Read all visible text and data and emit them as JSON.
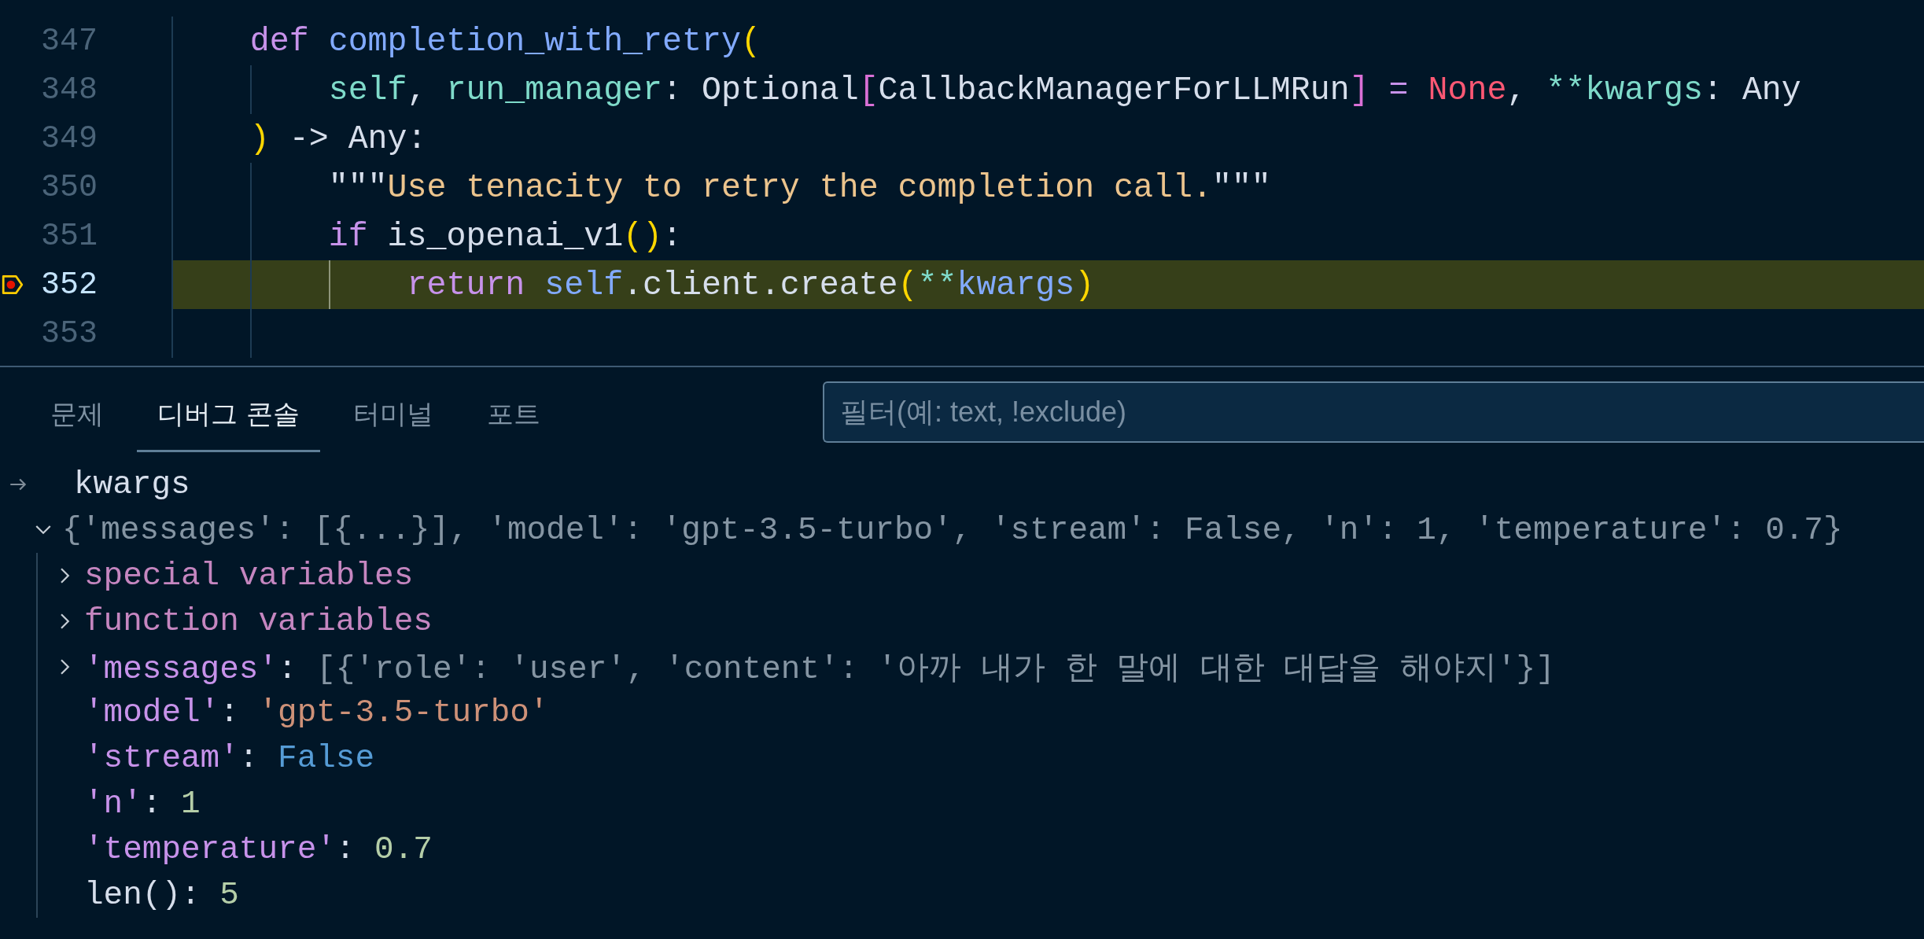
{
  "editor": {
    "lines": [
      {
        "number": "347",
        "current": false,
        "breakpoint": false,
        "tokens": [
          {
            "kind": "keyword",
            "text": "    def"
          },
          {
            "kind": "function",
            "text": " completion_with_retry"
          },
          {
            "kind": "bracket1",
            "text": "("
          }
        ]
      },
      {
        "number": "348",
        "current": false,
        "breakpoint": false,
        "tokens": [
          {
            "kind": "param",
            "text": "        self"
          },
          {
            "kind": "plain",
            "text": ", "
          },
          {
            "kind": "param",
            "text": "run_manager"
          },
          {
            "kind": "plain",
            "text": ": Optional"
          },
          {
            "kind": "bracket2",
            "text": "["
          },
          {
            "kind": "plain",
            "text": "CallbackManagerForLLMRun"
          },
          {
            "kind": "bracket2",
            "text": "]"
          },
          {
            "kind": "operator",
            "text": " = "
          },
          {
            "kind": "constant",
            "text": "None"
          },
          {
            "kind": "plain",
            "text": ", "
          },
          {
            "kind": "param",
            "text": "**kwargs"
          },
          {
            "kind": "plain",
            "text": ": Any"
          }
        ]
      },
      {
        "number": "349",
        "current": false,
        "breakpoint": false,
        "tokens": [
          {
            "kind": "bracket1",
            "text": "    )"
          },
          {
            "kind": "plain",
            "text": " -> Any:"
          }
        ]
      },
      {
        "number": "350",
        "current": false,
        "breakpoint": false,
        "tokens": [
          {
            "kind": "plain",
            "text": "        \"\"\""
          },
          {
            "kind": "string",
            "text": "Use tenacity to retry the completion call."
          },
          {
            "kind": "plain",
            "text": "\"\"\""
          }
        ]
      },
      {
        "number": "351",
        "current": false,
        "breakpoint": false,
        "tokens": [
          {
            "kind": "keyword",
            "text": "        if"
          },
          {
            "kind": "plain",
            "text": " is_openai_v1"
          },
          {
            "kind": "bracket1",
            "text": "()"
          },
          {
            "kind": "plain",
            "text": ":"
          }
        ]
      },
      {
        "number": "352",
        "current": true,
        "breakpoint": true,
        "tokens": [
          {
            "kind": "keyword",
            "text": "            return"
          },
          {
            "kind": "self",
            "text": " self"
          },
          {
            "kind": "plain",
            "text": ".client.create"
          },
          {
            "kind": "bracket1",
            "text": "("
          },
          {
            "kind": "param",
            "text": "**"
          },
          {
            "kind": "function",
            "text": "kwargs"
          },
          {
            "kind": "bracket1",
            "text": ")"
          }
        ]
      },
      {
        "number": "353",
        "current": false,
        "breakpoint": false
      }
    ]
  },
  "panel": {
    "tabs": [
      {
        "label": "문제",
        "selected": false
      },
      {
        "label": "디버그 콘솔",
        "selected": true
      },
      {
        "label": "터미널",
        "selected": false
      },
      {
        "label": "포트",
        "selected": false
      }
    ],
    "filter": {
      "placeholder": "필터(예: text, !exclude)"
    },
    "console": {
      "input": "kwargs",
      "result": {
        "expanded": true,
        "tokens": [
          {
            "kind": "summary",
            "text": "{'messages': [{...}], 'model': 'gpt-3.5-turbo', 'stream': False, 'n': 1, 'temperature': 0.7}"
          }
        ],
        "children": [
          {
            "expanded": false,
            "tokens": [
              {
                "kind": "group",
                "text": "special variables"
              }
            ]
          },
          {
            "expanded": false,
            "tokens": [
              {
                "kind": "group",
                "text": "function variables"
              }
            ]
          },
          {
            "expanded": false,
            "tokens": [
              {
                "kind": "key",
                "text": "'messages'"
              },
              {
                "kind": "plain",
                "text": ": "
              },
              {
                "kind": "summary",
                "text": "[{'role': 'user', 'content': '아까 내가 한 말에 대한 대답을 해야지'}]"
              }
            ]
          },
          {
            "tokens": [
              {
                "kind": "key",
                "text": "'model'"
              },
              {
                "kind": "plain",
                "text": ": "
              },
              {
                "kind": "string",
                "text": "'gpt-3.5-turbo'"
              }
            ]
          },
          {
            "tokens": [
              {
                "kind": "key",
                "text": "'stream'"
              },
              {
                "kind": "plain",
                "text": ": "
              },
              {
                "kind": "bool",
                "text": "False"
              }
            ]
          },
          {
            "tokens": [
              {
                "kind": "key",
                "text": "'n'"
              },
              {
                "kind": "plain",
                "text": ": "
              },
              {
                "kind": "number",
                "text": "1"
              }
            ]
          },
          {
            "tokens": [
              {
                "kind": "key",
                "text": "'temperature'"
              },
              {
                "kind": "plain",
                "text": ": "
              },
              {
                "kind": "number",
                "text": "0.7"
              }
            ]
          },
          {
            "tokens": [
              {
                "kind": "plain",
                "text": "len(): "
              },
              {
                "kind": "number",
                "text": "5"
              }
            ]
          }
        ]
      }
    }
  }
}
